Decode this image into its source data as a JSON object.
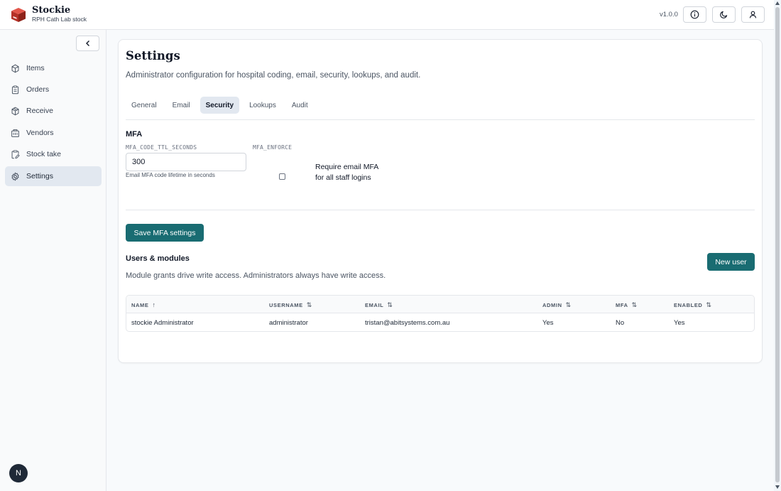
{
  "app": {
    "name": "Stockie",
    "subtitle": "RPH Cath Lab stock",
    "version": "v1.0.0"
  },
  "header_icons": [
    "info-icon",
    "moon-icon",
    "user-icon"
  ],
  "sidebar": {
    "items": [
      {
        "label": "Items",
        "icon": "cube-icon",
        "active": false
      },
      {
        "label": "Orders",
        "icon": "clipboard-icon",
        "active": false
      },
      {
        "label": "Receive",
        "icon": "package-icon",
        "active": false
      },
      {
        "label": "Vendors",
        "icon": "building-icon",
        "active": false
      },
      {
        "label": "Stock take",
        "icon": "clipboard-edit-icon",
        "active": false
      },
      {
        "label": "Settings",
        "icon": "gear-icon",
        "active": true
      }
    ],
    "avatar_initial": "N"
  },
  "page": {
    "title": "Settings",
    "description": "Administrator configuration for hospital coding, email, security, lookups, and audit.",
    "tabs": [
      {
        "label": "General",
        "active": false
      },
      {
        "label": "Email",
        "active": false
      },
      {
        "label": "Security",
        "active": true
      },
      {
        "label": "Lookups",
        "active": false
      },
      {
        "label": "Audit",
        "active": false
      }
    ]
  },
  "mfa": {
    "heading": "MFA",
    "ttl_label": "MFA_CODE_TTL_SECONDS",
    "ttl_value": "300",
    "ttl_help": "Email MFA code lifetime in seconds",
    "enforce_label": "MFA_ENFORCE",
    "enforce_text": "Require email MFA for all staff logins",
    "enforce_checked": false,
    "save_label": "Save MFA settings"
  },
  "users": {
    "heading": "Users & modules",
    "description": "Module grants drive write access. Administrators always have write access.",
    "new_user_label": "New user",
    "columns": [
      "NAME",
      "USERNAME",
      "EMAIL",
      "ADMIN",
      "MFA",
      "ENABLED"
    ],
    "rows": [
      {
        "name": "stockie Administrator",
        "username": "administrator",
        "email": "tristan@abitsystems.com.au",
        "admin": "Yes",
        "mfa": "No",
        "enabled": "Yes"
      }
    ]
  },
  "colors": {
    "primary": "#196c72",
    "active_bg": "#e2e8f0",
    "logo_red": "#c0392b"
  }
}
